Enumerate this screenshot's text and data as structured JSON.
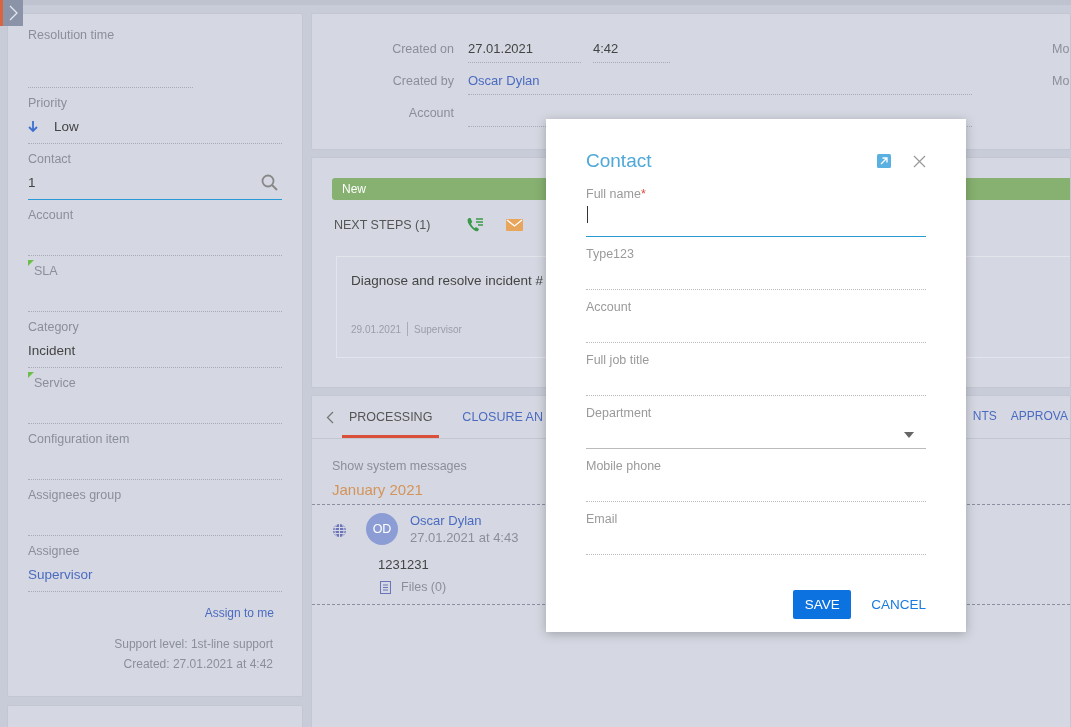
{
  "sidebar": {
    "fields": [
      {
        "label": "Resolution time",
        "kind": "short",
        "focused": false,
        "marked": false
      },
      {
        "label": "Priority",
        "value": "Low",
        "kind": "priority",
        "focused": false,
        "marked": false
      },
      {
        "label": "Contact",
        "value": "1",
        "kind": "lookup",
        "focused": true,
        "marked": false
      },
      {
        "label": "Account",
        "kind": "text",
        "focused": false,
        "marked": false
      },
      {
        "label": "SLA",
        "kind": "text",
        "focused": false,
        "marked": true
      },
      {
        "label": "Category",
        "value": "Incident",
        "kind": "text",
        "focused": false,
        "marked": false
      },
      {
        "label": "Service",
        "kind": "text",
        "focused": false,
        "marked": true
      },
      {
        "label": "Configuration item",
        "kind": "text",
        "focused": false,
        "marked": false
      },
      {
        "label": "Assignees group",
        "kind": "text",
        "focused": false,
        "marked": false
      },
      {
        "label": "Assignee",
        "value": "Supervisor",
        "kind": "link",
        "focused": false,
        "marked": false
      }
    ],
    "assign_link": "Assign to me",
    "support_level": "Support level: 1st-line support",
    "created": "Created: 27.01.2021 at 4:42"
  },
  "header": {
    "created_on_label": "Created on",
    "created_on_date": "27.01.2021",
    "created_on_time": "4:42",
    "created_by_label": "Created by",
    "created_by": "Oscar Dylan",
    "account_label": "Account",
    "right_labels": [
      "Mo",
      "Mo"
    ]
  },
  "status": "New",
  "next_steps": {
    "title": "NEXT STEPS (1)",
    "task": "Diagnose and resolve incident #",
    "task_date": "29.01.2021",
    "task_owner": "Supervisor"
  },
  "tabs_left": [
    {
      "label": "PROCESSING",
      "selected": true
    },
    {
      "label": "CLOSURE AN",
      "selected": false
    }
  ],
  "tabs_right": [
    {
      "label": "NTS",
      "selected": false
    },
    {
      "label": "APPROVA",
      "selected": false
    }
  ],
  "feed": {
    "filter": "Show system messages",
    "month": "January 2021",
    "post": {
      "initials": "OD",
      "author": "Oscar Dylan",
      "date": "27.01.2021 at 4:43",
      "text": "1231231",
      "files": "Files (0)"
    }
  },
  "dialog": {
    "title": "Contact",
    "fields": [
      {
        "label": "Full name",
        "kind": "text",
        "required": true,
        "focused": true
      },
      {
        "label": "Type123",
        "kind": "text",
        "required": false,
        "focused": false
      },
      {
        "label": "Account",
        "kind": "text",
        "required": false,
        "focused": false
      },
      {
        "label": "Full job title",
        "kind": "text",
        "required": false,
        "focused": false
      },
      {
        "label": "Department",
        "kind": "dropdown",
        "required": false,
        "focused": false
      },
      {
        "label": "Mobile phone",
        "kind": "text",
        "required": false,
        "focused": false
      },
      {
        "label": "Email",
        "kind": "text",
        "required": false,
        "focused": false
      }
    ],
    "required_mark": "*",
    "save": "SAVE",
    "cancel": "CANCEL"
  }
}
